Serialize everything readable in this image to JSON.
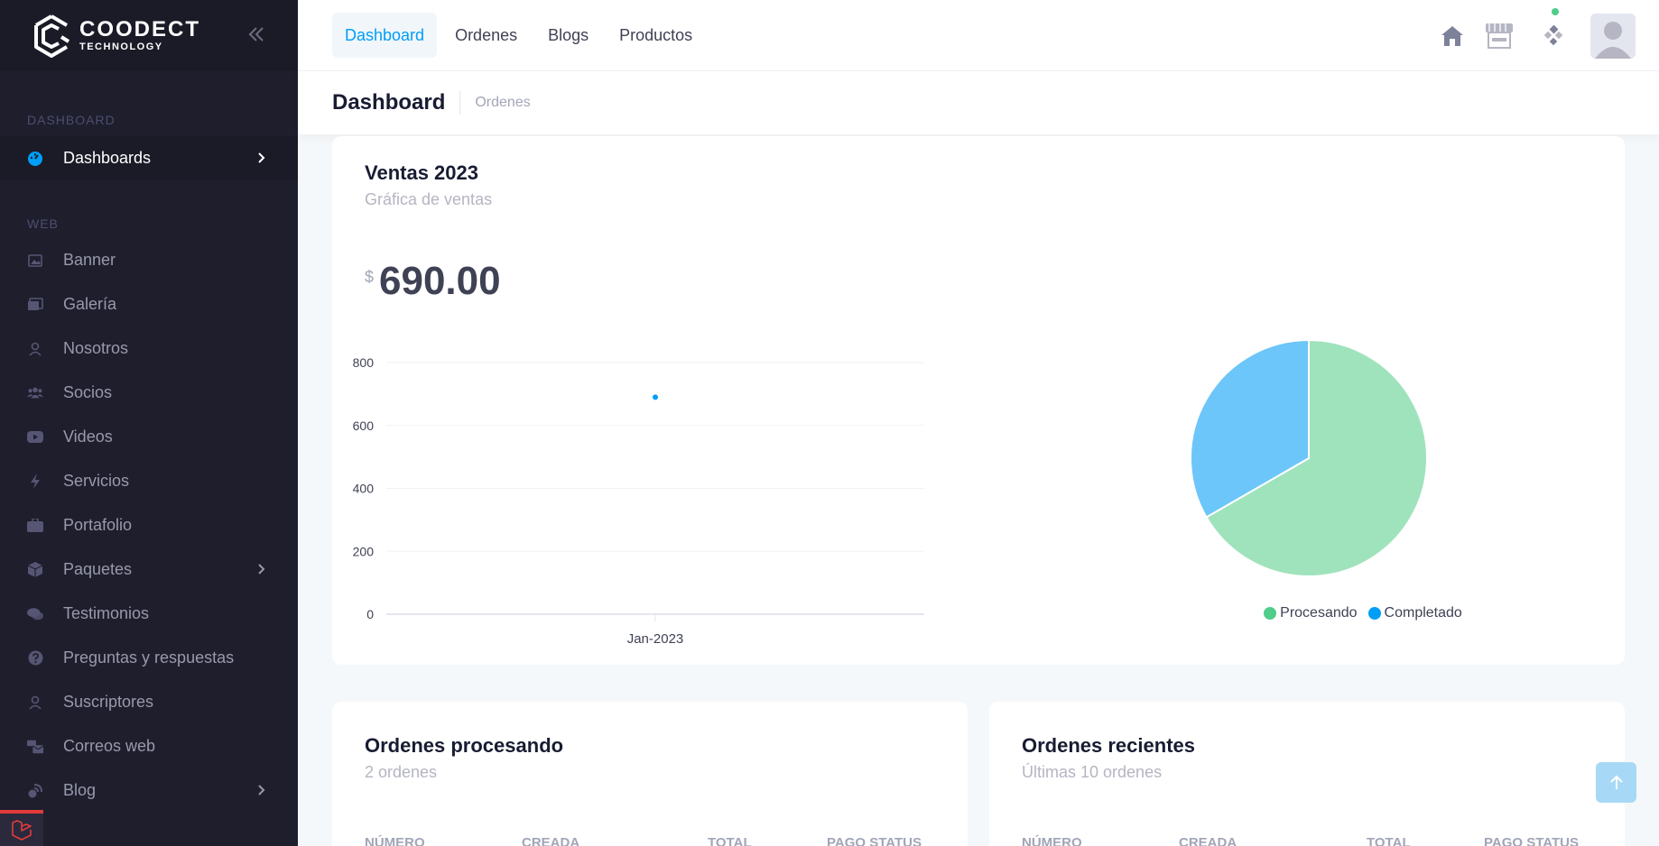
{
  "brand": {
    "line1": "COODECT",
    "line2": "TECHNOLOGY"
  },
  "sidebar": {
    "sections": [
      {
        "label": "DASHBOARD"
      },
      {
        "label": "WEB"
      }
    ],
    "items": [
      {
        "label": "Dashboards",
        "icon": "gauge-icon"
      },
      {
        "label": "Banner",
        "icon": "image-icon"
      },
      {
        "label": "Galería",
        "icon": "images-icon"
      },
      {
        "label": "Nosotros",
        "icon": "user-icon"
      },
      {
        "label": "Socios",
        "icon": "users-icon"
      },
      {
        "label": "Videos",
        "icon": "youtube-icon"
      },
      {
        "label": "Servicios",
        "icon": "bolt-icon"
      },
      {
        "label": "Portafolio",
        "icon": "briefcase-icon"
      },
      {
        "label": "Paquetes",
        "icon": "box-icon"
      },
      {
        "label": "Testimonios",
        "icon": "comments-icon"
      },
      {
        "label": "Preguntas y respuestas",
        "icon": "question-icon"
      },
      {
        "label": "Suscriptores",
        "icon": "user-icon"
      },
      {
        "label": "Correos web",
        "icon": "mail-bulk-icon"
      },
      {
        "label": "Blog",
        "icon": "blog-icon"
      }
    ]
  },
  "topnav": {
    "tabs": [
      {
        "label": "Dashboard"
      },
      {
        "label": "Ordenes"
      },
      {
        "label": "Blogs"
      },
      {
        "label": "Productos"
      }
    ]
  },
  "subheader": {
    "title": "Dashboard",
    "crumb": "Ordenes"
  },
  "sales_card": {
    "title": "Ventas 2023",
    "subtitle": "Gráfica de ventas",
    "currency": "$",
    "amount": "690.00"
  },
  "chart_data": [
    {
      "type": "line",
      "x": [
        "Jan-2023"
      ],
      "series": [
        {
          "values": [
            690
          ]
        }
      ],
      "ylim": [
        0,
        800
      ],
      "yticks": [
        "800",
        "600",
        "400",
        "200",
        "0"
      ],
      "grid": true,
      "color": "#009ef7"
    },
    {
      "type": "pie",
      "labels": [
        "Procesando",
        "Completado"
      ],
      "values": [
        2,
        1
      ],
      "colors": [
        "#9fe3bc",
        "#6cc6f9"
      ],
      "legend_colors": [
        "#50cd89",
        "#009ef7"
      ],
      "legend": "bottom"
    }
  ],
  "orders_processing": {
    "title": "Ordenes procesando",
    "subtitle": "2 ordenes",
    "columns": [
      "NÚMERO",
      "CREADA",
      "TOTAL",
      "PAGO STATUS"
    ]
  },
  "orders_recent": {
    "title": "Ordenes recientes",
    "subtitle": "Últimas 10 ordenes",
    "columns": [
      "NÚMERO",
      "CREADA",
      "TOTAL",
      "PAGO STATUS"
    ]
  },
  "colors": {
    "primary": "#009ef7",
    "sidebar": "#1e1e2d",
    "success": "#50cd89"
  }
}
